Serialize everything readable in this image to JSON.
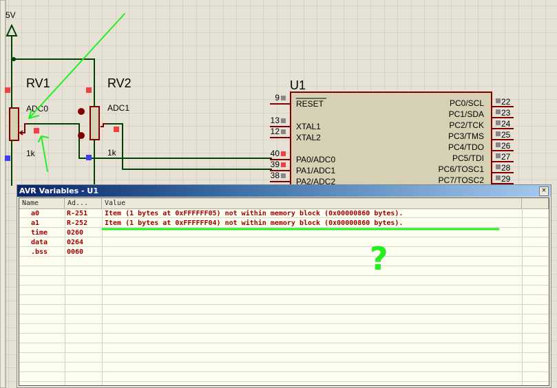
{
  "schematic": {
    "power_label": "5V",
    "rv1": {
      "name": "RV1",
      "net": "ADC0",
      "value": "1k"
    },
    "rv2": {
      "name": "RV2",
      "net": "ADC1",
      "value": "1k"
    },
    "u1": {
      "name": "U1",
      "left_pins": [
        {
          "num": "9",
          "label": "RESET"
        },
        {
          "num": "13",
          "label": "XTAL1"
        },
        {
          "num": "12",
          "label": "XTAL2"
        },
        {
          "num": "40",
          "label": "PA0/ADC0"
        },
        {
          "num": "39",
          "label": "PA1/ADC1"
        },
        {
          "num": "38",
          "label": "PA2/ADC2"
        }
      ],
      "right_pins": [
        {
          "num": "22",
          "label": "PC0/SCL"
        },
        {
          "num": "23",
          "label": "PC1/SDA"
        },
        {
          "num": "24",
          "label": "PC2/TCK"
        },
        {
          "num": "25",
          "label": "PC3/TMS"
        },
        {
          "num": "26",
          "label": "PC4/TDO"
        },
        {
          "num": "27",
          "label": "PC5/TDI"
        },
        {
          "num": "28",
          "label": "PC6/TOSC1"
        },
        {
          "num": "29",
          "label": "PC7/TOSC2"
        }
      ]
    }
  },
  "window": {
    "title": "AVR Variables - U1",
    "close_label": "×",
    "columns": [
      "Name",
      "Ad...",
      "Value"
    ],
    "rows": [
      {
        "name": "a0",
        "address": "R-251",
        "value": "Item (1 bytes at 0xFFFFFF05) not within memory block (0x00000860 bytes)."
      },
      {
        "name": "a1",
        "address": "R-252",
        "value": "Item (1 bytes at 0xFFFFFF04) not within memory block (0x00000860 bytes)."
      },
      {
        "name": "time",
        "address": "0260",
        "value": ""
      },
      {
        "name": "data",
        "address": "0264",
        "value": ""
      },
      {
        "name": ".bss",
        "address": "0060",
        "value": ""
      }
    ]
  },
  "annotation": {
    "mark": "?",
    "color": "#22ee22"
  },
  "colors": {
    "wire": "#004000",
    "component": "#800000",
    "value_text": "#a00000"
  }
}
